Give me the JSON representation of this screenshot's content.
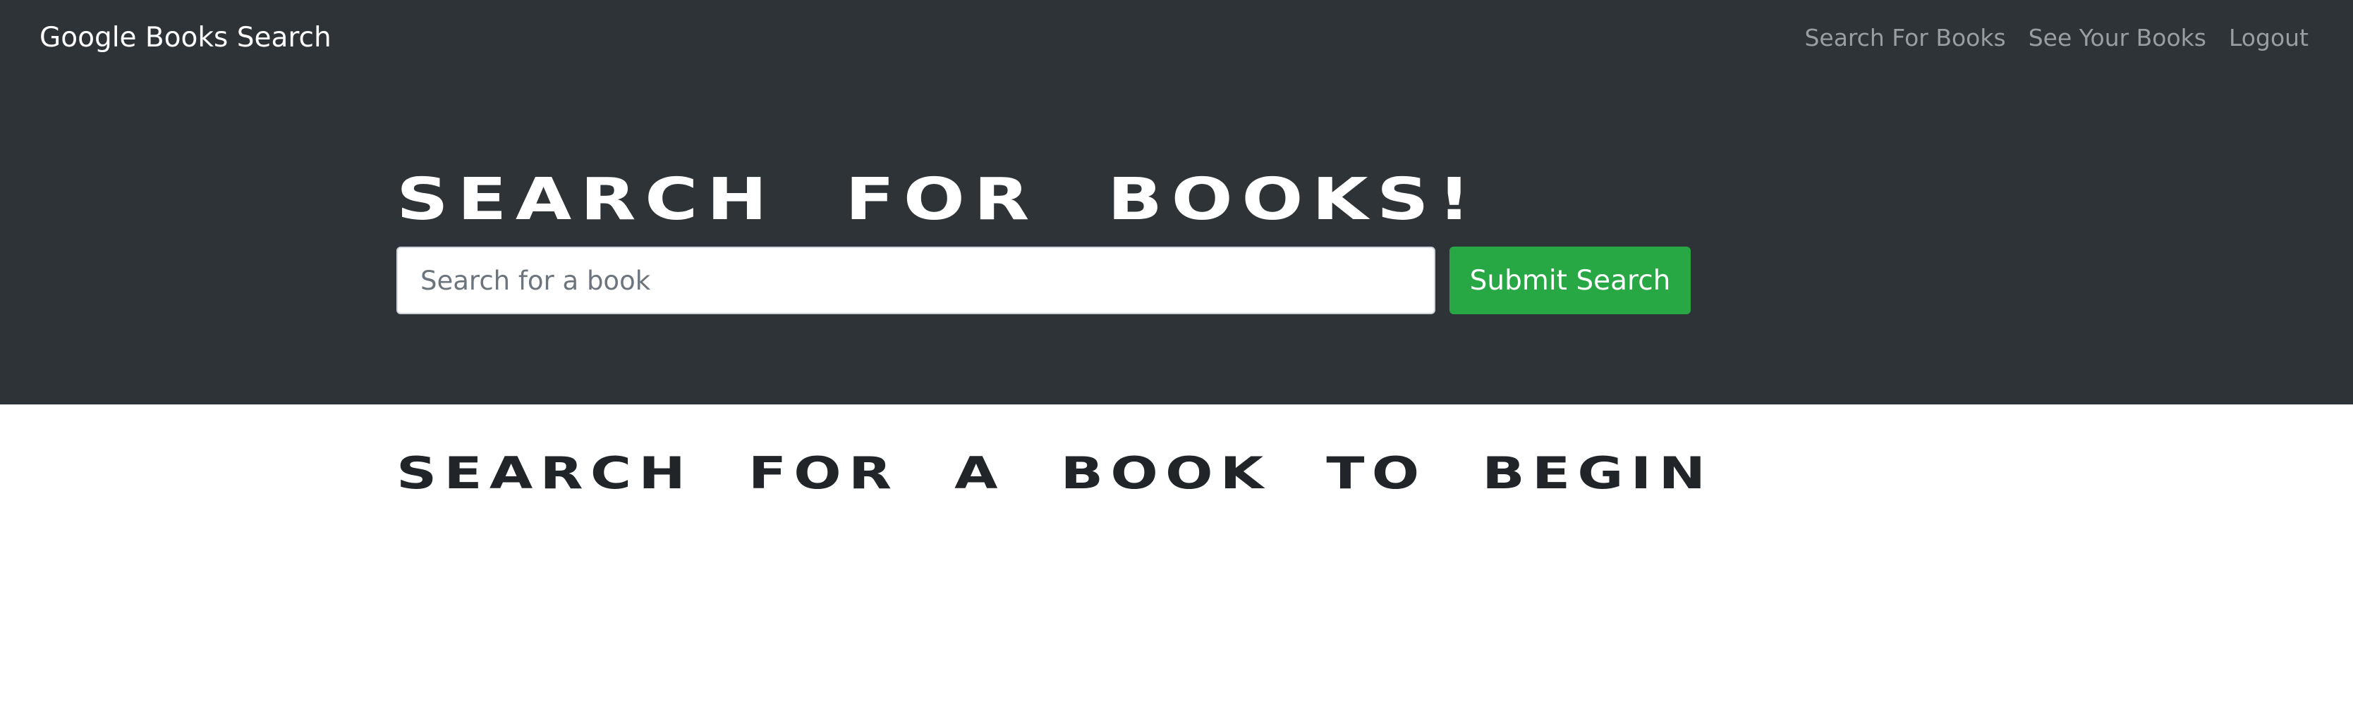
{
  "navbar": {
    "brand": "Google Books Search",
    "links": [
      "Search For Books",
      "See Your Books",
      "Logout"
    ]
  },
  "jumbotron": {
    "title": "Search for Books!",
    "search_placeholder": "Search for a book",
    "search_value": "",
    "submit_label": "Submit Search"
  },
  "results": {
    "heading": "Search for a book to begin"
  },
  "colors": {
    "navbar_bg": "#2e3338",
    "submit_button": "#28a745",
    "nav_link": "#9a9da1"
  }
}
